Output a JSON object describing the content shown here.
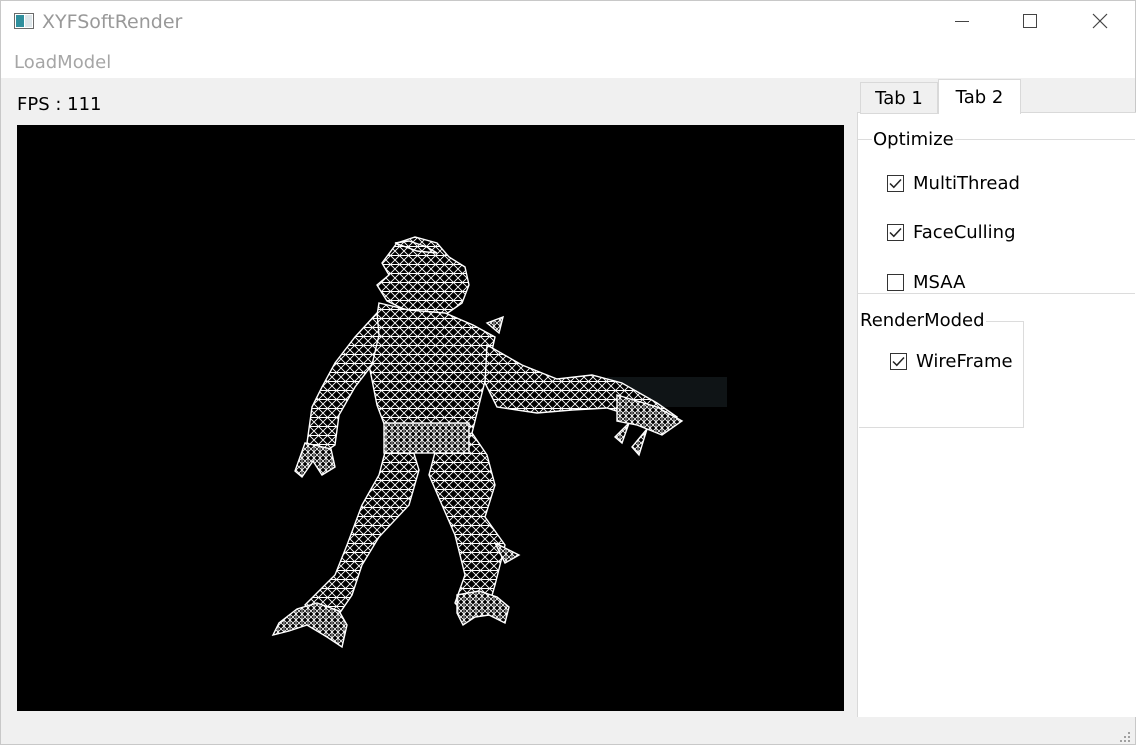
{
  "window": {
    "title": "XYFSoftRender",
    "icon": "app-window-icon",
    "controls": [
      "minimize-icon",
      "maximize-icon",
      "close-icon"
    ]
  },
  "menu": {
    "items": [
      {
        "label": "LoadModel"
      }
    ]
  },
  "status": {
    "fps_text": "FPS : 111"
  },
  "viewport": {
    "background": "#000000",
    "wire_color": "#ffffff"
  },
  "tabs": [
    {
      "label": "Tab 1",
      "active": false
    },
    {
      "label": "Tab 2",
      "active": true
    }
  ],
  "optimize": {
    "title": "Optimize",
    "options": [
      {
        "label": "MultiThread",
        "checked": true
      },
      {
        "label": "FaceCulling",
        "checked": true
      },
      {
        "label": "MSAA",
        "checked": false
      }
    ]
  },
  "render_mode": {
    "title": "RenderModed",
    "options": [
      {
        "label": "WireFrame",
        "checked": true
      }
    ]
  }
}
